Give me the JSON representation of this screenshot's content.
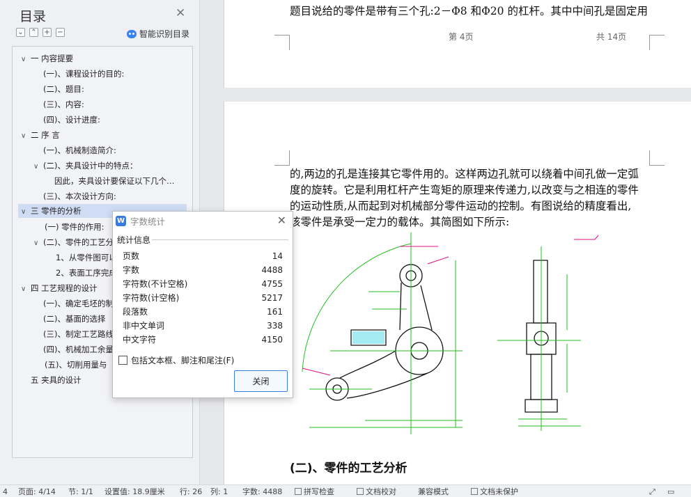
{
  "nav": {
    "title": "目录",
    "smart_toc": "智能识别目录",
    "tools": [
      "⌄",
      "⌃",
      "+",
      "−"
    ],
    "items": [
      {
        "label": "一   内容提要",
        "chev": "∨"
      },
      {
        "label": "(一)、课程设计的目的:",
        "chev": ""
      },
      {
        "label": "(二)、题目:",
        "chev": ""
      },
      {
        "label": "(三)、内容:",
        "chev": ""
      },
      {
        "label": "(四)、设计进度:",
        "chev": ""
      },
      {
        "label": "二   序      言",
        "chev": "∨"
      },
      {
        "label": "(一)、机械制造简介:",
        "chev": ""
      },
      {
        "label": "(二)、夹具设计中的特点：",
        "chev": "∨"
      },
      {
        "label": "因此，夹具设计要保证以下几个…",
        "chev": ""
      },
      {
        "label": "(三)、本次设计方向:",
        "chev": ""
      },
      {
        "label": "三   零件的分析",
        "chev": "∨"
      },
      {
        "label": "(一) 零件的作用:",
        "chev": ""
      },
      {
        "label": "(二)、零件的工艺分",
        "chev": "∨"
      },
      {
        "label": "1、从零件图可以",
        "chev": ""
      },
      {
        "label": "2、表面工序完成",
        "chev": ""
      },
      {
        "label": "四  工艺规程的设计",
        "chev": "∨"
      },
      {
        "label": "(一)、确定毛坯的制",
        "chev": ""
      },
      {
        "label": "(二)、基面的选择",
        "chev": ""
      },
      {
        "label": "(三)、制定工艺路线",
        "chev": ""
      },
      {
        "label": "(四)、机械加工余量",
        "chev": ""
      },
      {
        "label": "(五)、切削用量与",
        "chev": ""
      },
      {
        "label": "五   夹具的设计",
        "chev": ""
      }
    ]
  },
  "doc": {
    "page1_line": "题目说给的零件是带有三个孔:2－Φ8 和Φ20 的杠杆。其中中间孔是固定用",
    "footer_page": "第 4页",
    "footer_total": "共 14页",
    "para_lines": [
      "的,两边的孔是连接其它零件用的。这样两边孔就可以绕着中间孔做一定弧",
      "度的旋转。它是利用杠杆产生弯矩的原理来传递力,以改变与之相连的零件",
      "的运动性质,从而起到对机械部分零件运动的控制。有图说给的精度看出,",
      "该零件是承受一定力的载体。其简图如下所示:"
    ],
    "heading": "(二)、零件的工艺分析"
  },
  "word_count": {
    "title": "字数统计",
    "section": "统计信息",
    "rows": [
      {
        "label": "页数",
        "value": "14"
      },
      {
        "label": "字数",
        "value": "4488"
      },
      {
        "label": "字符数(不计空格)",
        "value": "4755"
      },
      {
        "label": "字符数(计空格)",
        "value": "5217"
      },
      {
        "label": "段落数",
        "value": "161"
      },
      {
        "label": "非中文单词",
        "value": "338"
      },
      {
        "label": "中文字符",
        "value": "4150"
      }
    ],
    "checkbox": "包括文本框、脚注和尾注(F)",
    "close": "关闭"
  },
  "status": {
    "page": "页面: 4/14",
    "section": "节: 1/1",
    "setting": "设置值: 18.9厘米",
    "row": "行: 26",
    "col": "列: 1",
    "words": "字数: 4488",
    "spell": "拼写检查",
    "proof": "文档校对",
    "compat": "兼容模式",
    "unsaved": "文档未保护"
  }
}
